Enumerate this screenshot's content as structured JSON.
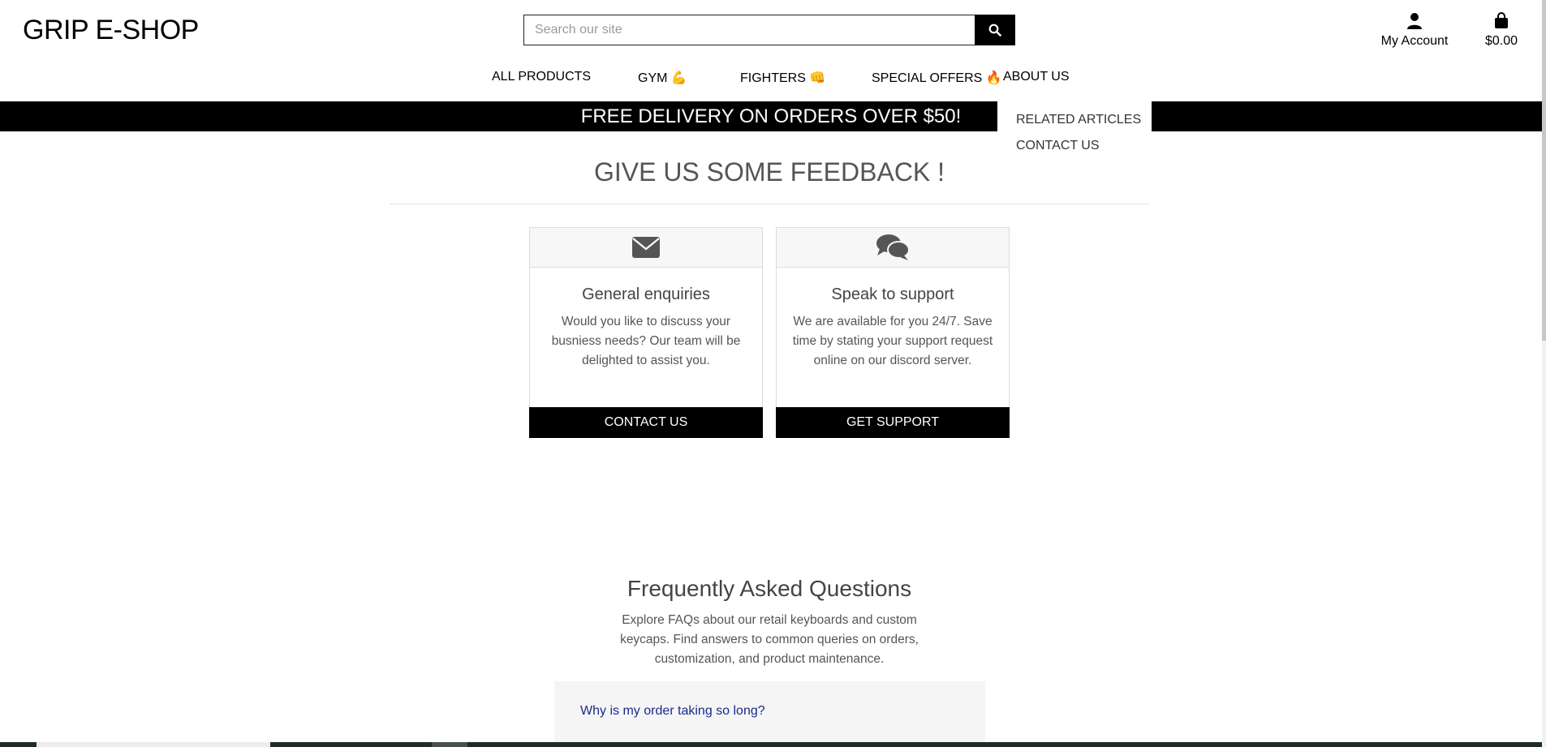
{
  "header": {
    "brand": "GRIP E-SHOP",
    "search": {
      "placeholder": "Search our site",
      "icon": "search-icon"
    },
    "account_label": "My Account",
    "cart_total": "$0.00"
  },
  "nav": {
    "items": [
      {
        "label": "ALL PRODUCTS",
        "emoji": ""
      },
      {
        "label": "GYM",
        "emoji": "💪"
      },
      {
        "label": "FIGHTERS",
        "emoji": "👊"
      },
      {
        "label": "SPECIAL OFFERS",
        "emoji": "🔥"
      },
      {
        "label": "ABOUT US",
        "emoji": ""
      }
    ],
    "dropdown": [
      "RELATED ARTICLES",
      "CONTACT US"
    ]
  },
  "banner": "FREE DELIVERY ON ORDERS OVER $50!",
  "feedback": {
    "title": "GIVE US SOME FEEDBACK !",
    "cards": [
      {
        "icon": "envelope-icon",
        "title": "General enquiries",
        "text": "Would you like to discuss your busniess needs? Our team will be delighted to assist you.",
        "button": "CONTACT US"
      },
      {
        "icon": "chat-bubbles-icon",
        "title": "Speak to support",
        "text": "We are available for you 24/7. Save time by stating your support request online on our discord server.",
        "button": "GET SUPPORT"
      }
    ]
  },
  "faq": {
    "title": "Frequently Asked Questions",
    "text": "Explore FAQs about our retail keyboards and custom keycaps. Find answers to common queries on orders, customization, and product maintenance.",
    "questions": [
      "Why is my order taking so long?"
    ]
  },
  "colors": {
    "primary": "#000000",
    "text": "#555555",
    "link": "#1a2a8a",
    "card_header": "#f7f7f7"
  }
}
